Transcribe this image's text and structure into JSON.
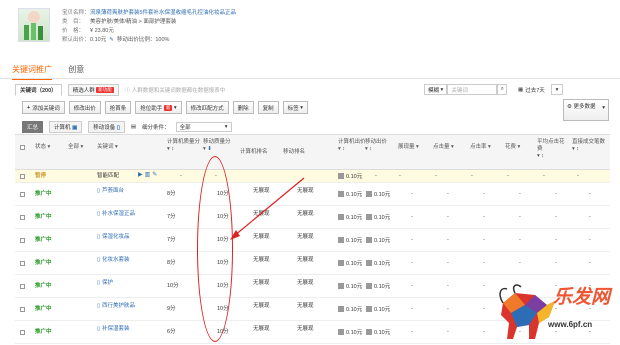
{
  "product": {
    "title_label": "宝贝名称：",
    "title": "流泉薄荷爽肤护套装5件套补水保湿收缩毛孔控油化妆品正品",
    "category_label": "类　目：",
    "category": "美容护肤/美体/精油 > 面部护理套装",
    "price_label": "价　格：",
    "price": "¥ 23.80元",
    "default_bid_label": "默认出价：",
    "default_bid": "0.10元",
    "mobile_ratio_label": "移动出价比例：",
    "mobile_ratio": "100%"
  },
  "tabs": {
    "active": "关键词推广",
    "other": "创意"
  },
  "subtabs": {
    "keywords": "关键词（200）",
    "precise": "精选人群",
    "hot_badge": "新功能",
    "hint": "人群数据和关键词数据都在数据报表中"
  },
  "right_controls": {
    "select": "模糊",
    "search_placeholder": "关键词",
    "date": "过去7天"
  },
  "toolbar": [
    "添加关键词",
    "修改出价",
    "抢首条",
    "抢位助手",
    "修改匹配方式",
    "删除",
    "复制",
    "标签"
  ],
  "toolbar_new_badge": "新",
  "more_data_label": "更多数据",
  "filter": {
    "all": "汇总",
    "computer": "计算机",
    "mobile": "移动设备",
    "condition_label": "细分条件：",
    "condition_value": "全部"
  },
  "columns": [
    "状态",
    "全部",
    "关键词",
    "计算机质量分",
    "移动质量分",
    "计算机排名",
    "移动排名",
    "计算机出价",
    "移动出价",
    "展现量",
    "点击量",
    "点击率",
    "花费",
    "平均点击花费",
    "直接成交笔数"
  ],
  "smart_row": {
    "status": "暂停",
    "keyword": "智能匹配",
    "bid": "0.10元"
  },
  "rows": [
    {
      "status": "推广中",
      "keyword": "芦荟面台",
      "pc_q": "8分",
      "m_q": "10分",
      "pc_rank": "无展现",
      "m_rank": "无展现",
      "pc_bid": "0.10元",
      "m_bid": "0.10元"
    },
    {
      "status": "推广中",
      "keyword": "补水保湿正品",
      "pc_q": "7分",
      "m_q": "10分",
      "pc_rank": "无展现",
      "m_rank": "无展现",
      "pc_bid": "0.10元",
      "m_bid": "0.10元"
    },
    {
      "status": "推广中",
      "keyword": "保湿化妆品",
      "pc_q": "7分",
      "m_q": "10分",
      "pc_rank": "无展现",
      "m_rank": "无展现",
      "pc_bid": "0.10元",
      "m_bid": "0.10元"
    },
    {
      "status": "推广中",
      "keyword": "化妆水套装",
      "pc_q": "8分",
      "m_q": "10分",
      "pc_rank": "无展现",
      "m_rank": "无展现",
      "pc_bid": "0.10元",
      "m_bid": "0.10元"
    },
    {
      "status": "推广中",
      "keyword": "保护",
      "pc_q": "10分",
      "m_q": "10分",
      "pc_rank": "无展现",
      "m_rank": "无展现",
      "pc_bid": "0.10元",
      "m_bid": "0.10元"
    },
    {
      "status": "推广中",
      "keyword": "西行美护肤品",
      "pc_q": "9分",
      "m_q": "10分",
      "pc_rank": "无展现",
      "m_rank": "无展现",
      "pc_bid": "0.10元",
      "m_bid": "0.10元"
    },
    {
      "status": "推广中",
      "keyword": "补保湿套装",
      "pc_q": "6分",
      "m_q": "10分",
      "pc_rank": "无展现",
      "m_rank": "无展现",
      "pc_bid": "0.10元",
      "m_bid": "0.10元"
    },
    {
      "status": "",
      "keyword": "",
      "pc_q": "",
      "m_q": "",
      "pc_rank": "无展现",
      "m_rank": "无展现",
      "pc_bid": "",
      "m_bid": ""
    }
  ],
  "dash": "-",
  "watermark": {
    "logo_text": "乐发网",
    "url": "www.6pf.cn"
  },
  "colors": {
    "accent": "#ff6600",
    "link": "#2d6db5",
    "status_green": "#2a9a2a",
    "annotation_red": "#dd2222"
  }
}
